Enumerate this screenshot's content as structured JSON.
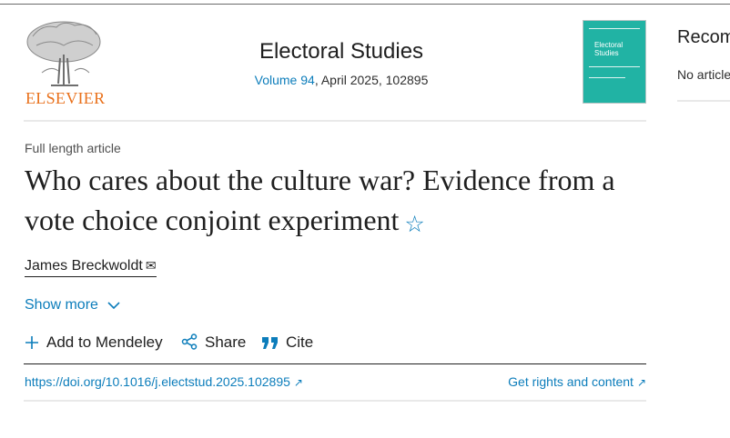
{
  "publisher": {
    "logo_text": "ELSEVIER",
    "logo_icon": "tree-logo-icon"
  },
  "journal": {
    "title": "Electoral Studies",
    "volume_link": "Volume 94",
    "issue_info": ", April 2025, 102895",
    "cover_title_line1": "Electoral",
    "cover_title_line2": "Studies"
  },
  "sidebar": {
    "title": "Recom",
    "text": "No article"
  },
  "article": {
    "type": "Full length article",
    "title": "Who cares about the culture war? Evidence from a vote choice conjoint experiment",
    "author": "James Breckwoldt",
    "show_more": "Show more"
  },
  "actions": {
    "mendeley": "Add to Mendeley",
    "share": "Share",
    "cite": "Cite"
  },
  "links": {
    "doi": "https://doi.org/10.1016/j.electstud.2025.102895",
    "rights": "Get rights and content"
  },
  "colors": {
    "link": "#0c7dbb",
    "brand": "#e9711c",
    "cover": "#21b3a4"
  }
}
